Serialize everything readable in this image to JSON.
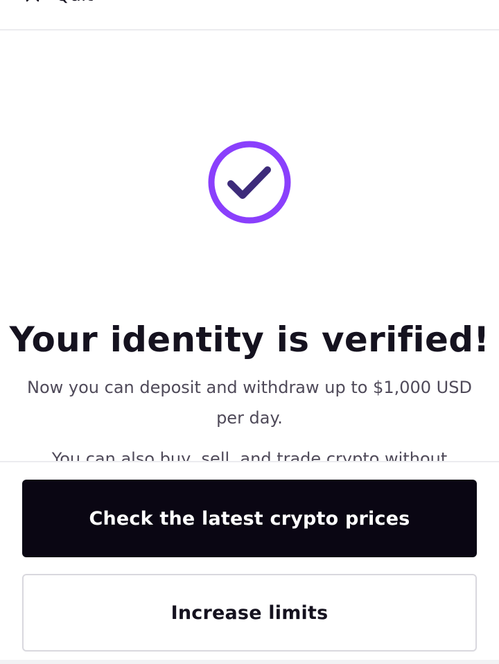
{
  "header": {
    "quit_label": "Quit",
    "quit_icon": "close-icon"
  },
  "status_icon": "check-circle-icon",
  "colors": {
    "accent": "#8a3ffc",
    "primary_button_bg": "#0a0613",
    "text": "#15121f",
    "muted_text": "#4f4a59"
  },
  "main": {
    "title": "Your identity is verified!",
    "description": "Now you can deposit and withdraw up to $1,000 USD per day.",
    "description_2": "You can also buy, sell, and trade crypto without"
  },
  "actions": {
    "primary_label": "Check the latest crypto prices",
    "secondary_label": "Increase limits"
  }
}
